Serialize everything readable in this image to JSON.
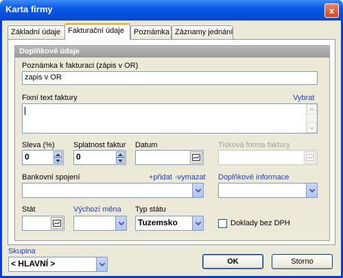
{
  "window": {
    "title": "Karta firmy",
    "close_glyph": "x"
  },
  "tabs": [
    {
      "label": "Základní údaje",
      "active": false
    },
    {
      "label": "Fakturační údaje",
      "active": true
    },
    {
      "label": "Poznámka",
      "active": false
    },
    {
      "label": "Záznamy jednání",
      "active": false
    }
  ],
  "section": {
    "title": "Doplňkové údaje"
  },
  "form": {
    "poznamka": {
      "label": "Poznámka k fakturaci (zápis v OR)",
      "value": "zapis v OR"
    },
    "fixni_text": {
      "label": "Fixní text faktury",
      "link": "Vybrat",
      "value": ""
    },
    "sleva": {
      "label": "Sleva (%)",
      "value": "0"
    },
    "splatnost": {
      "label": "Splatnost faktur",
      "value": "0"
    },
    "datum": {
      "label": "Datum",
      "value": ""
    },
    "tiskova_forma": {
      "label": "Tisková forma faktury",
      "value": "",
      "disabled": true
    },
    "bankovni_spojeni": {
      "label": "Bankovní spojení",
      "link_add": "+přidat",
      "link_remove": "-vymazat",
      "value": ""
    },
    "doplnkove_informace": {
      "label": "Doplňkové informace",
      "value": ""
    },
    "stat": {
      "label": "Stát",
      "value": ""
    },
    "vychozi_mena": {
      "label": "Výchozí měna",
      "value": ""
    },
    "typ_statu": {
      "label": "Typ státu",
      "value": "Tuzemsko"
    },
    "doklady_bez_dph": {
      "label": "Doklady bez DPH",
      "checked": false
    }
  },
  "footer": {
    "skupina": {
      "label": "Skupina",
      "value": "< HLAVNÍ >"
    },
    "ok_label": "OK",
    "storno_label": "Storno"
  },
  "colors": {
    "accent": "#0a5ae5",
    "link": "#1c3fb8",
    "tab_highlight": "#f0a010"
  }
}
